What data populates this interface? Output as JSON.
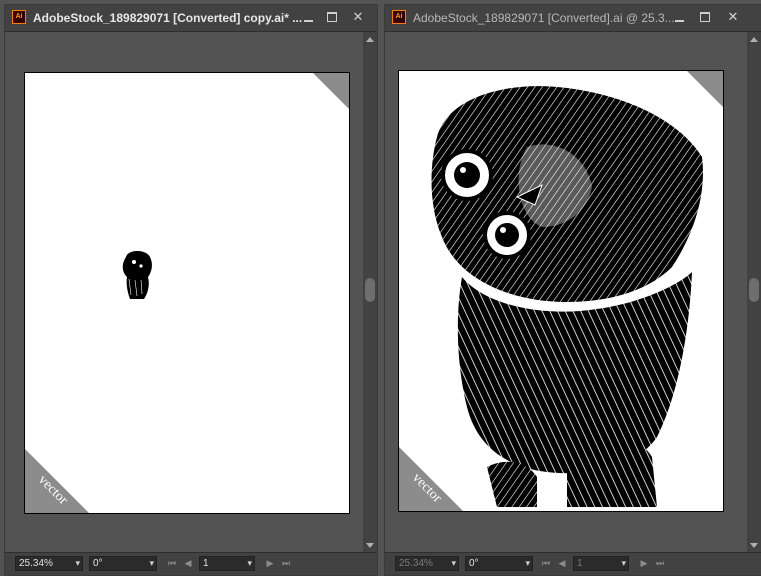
{
  "windows": [
    {
      "title": "AdobeStock_189829071 [Converted] copy.ai* ...",
      "icon": "illustrator-icon",
      "icon_text": "Ai",
      "artboard_label": "vector",
      "status": {
        "zoom": "25.34%",
        "rotation": "0°",
        "artboard": "1"
      }
    },
    {
      "title": "AdobeStock_189829071 [Converted].ai @ 25.3...",
      "icon": "illustrator-icon",
      "icon_text": "Ai",
      "artboard_label": "vector",
      "status": {
        "zoom": "25.34%",
        "rotation": "0°",
        "artboard": "1"
      }
    }
  ],
  "colors": {
    "chrome": "#424242",
    "workspace": "#535353",
    "accent": "#ff7c00"
  }
}
